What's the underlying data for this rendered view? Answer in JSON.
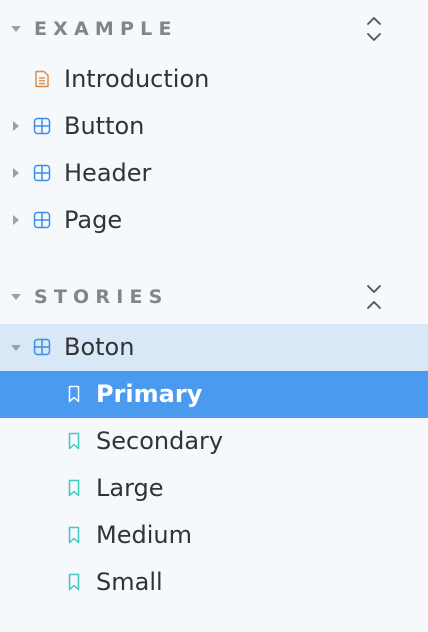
{
  "sections": [
    {
      "title": "EXAMPLE",
      "toggle_icon": "expand-all-icon",
      "items": [
        {
          "label": "Introduction",
          "icon": "document-icon",
          "color": "#e3873a"
        },
        {
          "label": "Button",
          "icon": "component-icon",
          "color": "#3b8ee6"
        },
        {
          "label": "Header",
          "icon": "component-icon",
          "color": "#3b8ee6"
        },
        {
          "label": "Page",
          "icon": "component-icon",
          "color": "#3b8ee6"
        }
      ]
    },
    {
      "title": "STORIES",
      "toggle_icon": "collapse-all-icon",
      "component": {
        "label": "Boton",
        "icon": "component-icon",
        "expanded": true
      },
      "stories": [
        {
          "label": "Primary",
          "icon": "bookmark-icon",
          "selected": true
        },
        {
          "label": "Secondary",
          "icon": "bookmark-icon"
        },
        {
          "label": "Large",
          "icon": "bookmark-icon"
        },
        {
          "label": "Medium",
          "icon": "bookmark-icon"
        },
        {
          "label": "Small",
          "icon": "bookmark-icon"
        }
      ]
    }
  ],
  "colors": {
    "background": "#f6f9fc",
    "selected_background": "#4a9bf0",
    "expanded_background": "#d9e8f7",
    "component_icon": "#3b8ee6",
    "story_icon": "#3fc7c0",
    "document_icon": "#e3873a",
    "section_title": "#7f868d"
  }
}
